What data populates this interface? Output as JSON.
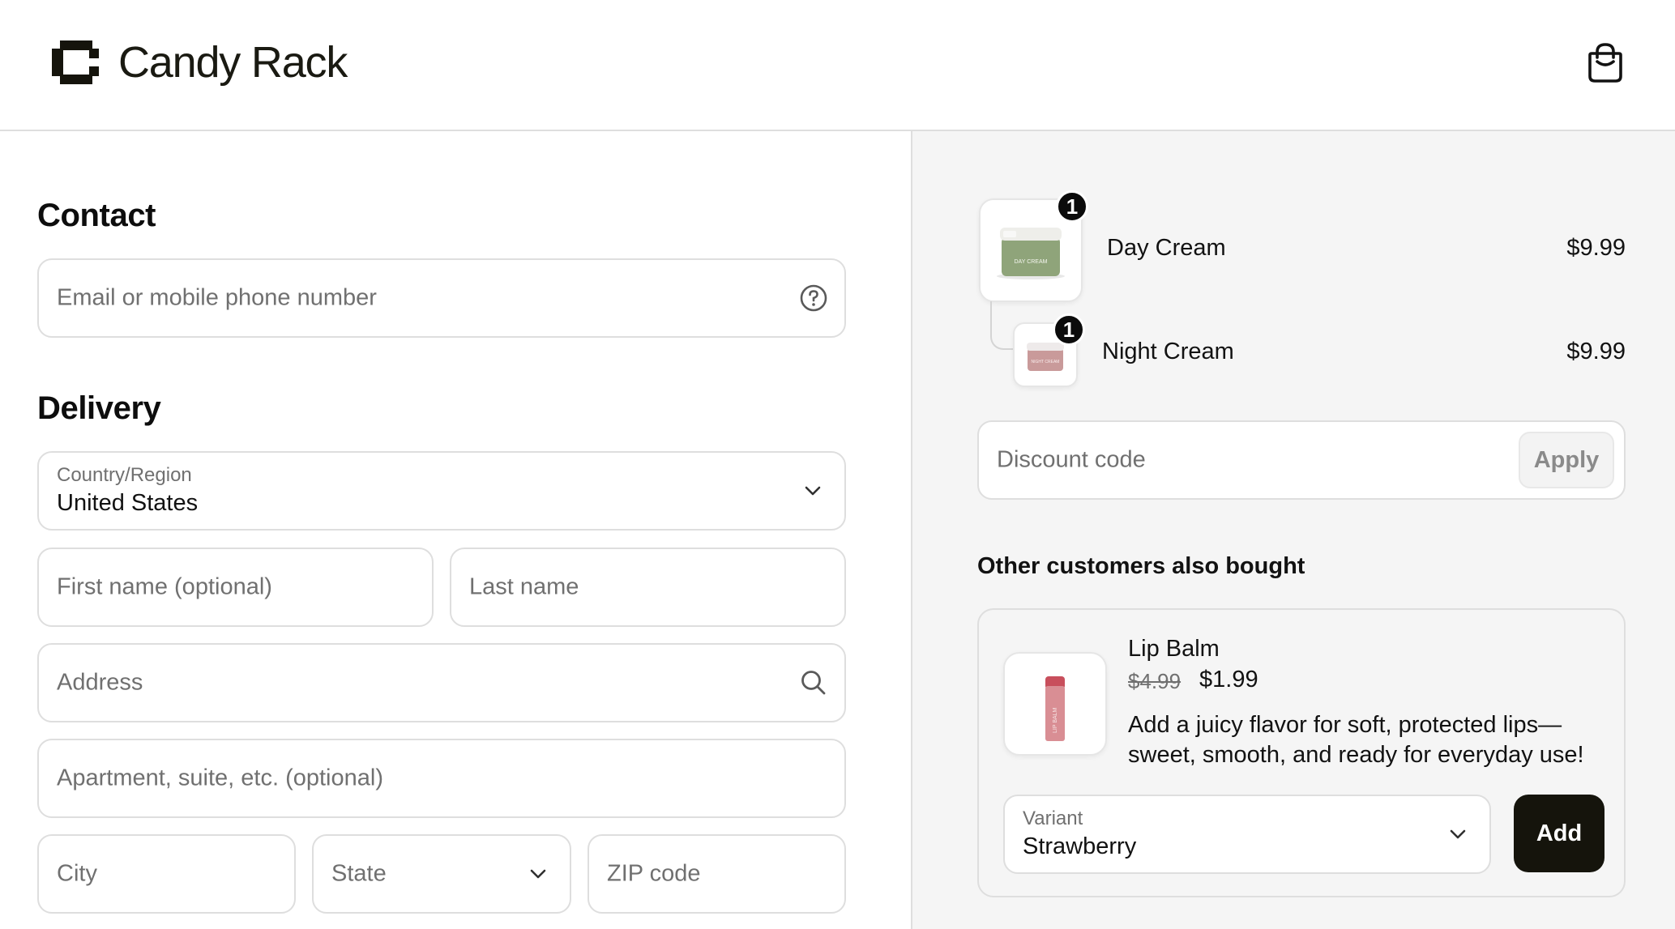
{
  "brand": {
    "name": "Candy Rack"
  },
  "header": {
    "cart_icon": "shopping-bag-icon"
  },
  "contact": {
    "heading": "Contact",
    "email": {
      "placeholder": "Email or mobile phone number",
      "icon": "help-circle-icon"
    }
  },
  "delivery": {
    "heading": "Delivery",
    "country": {
      "label": "Country/Region",
      "value": "United States"
    },
    "first_name": {
      "placeholder": "First name (optional)"
    },
    "last_name": {
      "placeholder": "Last name"
    },
    "address": {
      "placeholder": "Address",
      "icon": "search-icon"
    },
    "apartment": {
      "placeholder": "Apartment, suite, etc. (optional)"
    },
    "city": {
      "placeholder": "City"
    },
    "state": {
      "placeholder": "State"
    },
    "zip": {
      "placeholder": "ZIP code"
    }
  },
  "cart": {
    "items": [
      {
        "name": "Day Cream",
        "price": "$9.99",
        "quantity": "1"
      },
      {
        "name": "Night Cream",
        "price": "$9.99",
        "quantity": "1"
      }
    ]
  },
  "discount": {
    "placeholder": "Discount code",
    "apply_label": "Apply"
  },
  "upsell": {
    "heading": "Other customers also bought",
    "product": {
      "name": "Lip Balm",
      "old_price": "$4.99",
      "price": "$1.99",
      "description": "Add a juicy flavor for soft, protected lips—sweet, smooth, and ready for everyday use!",
      "image_text": "LIP BALM"
    },
    "variant": {
      "label": "Variant",
      "value": "Strawberry"
    },
    "add_label": "Add"
  },
  "product_image_text": {
    "day": "DAY CREAM",
    "night": "NIGHT CREAM"
  },
  "colors": {
    "accent_dark": "#15140c",
    "border": "#dedede",
    "sidebar_bg": "#f5f5f5",
    "placeholder": "#707070",
    "day_cream_jar": "#8fa47a",
    "night_cream_jar": "#c99a9a",
    "lip_balm": "#d98e94"
  }
}
